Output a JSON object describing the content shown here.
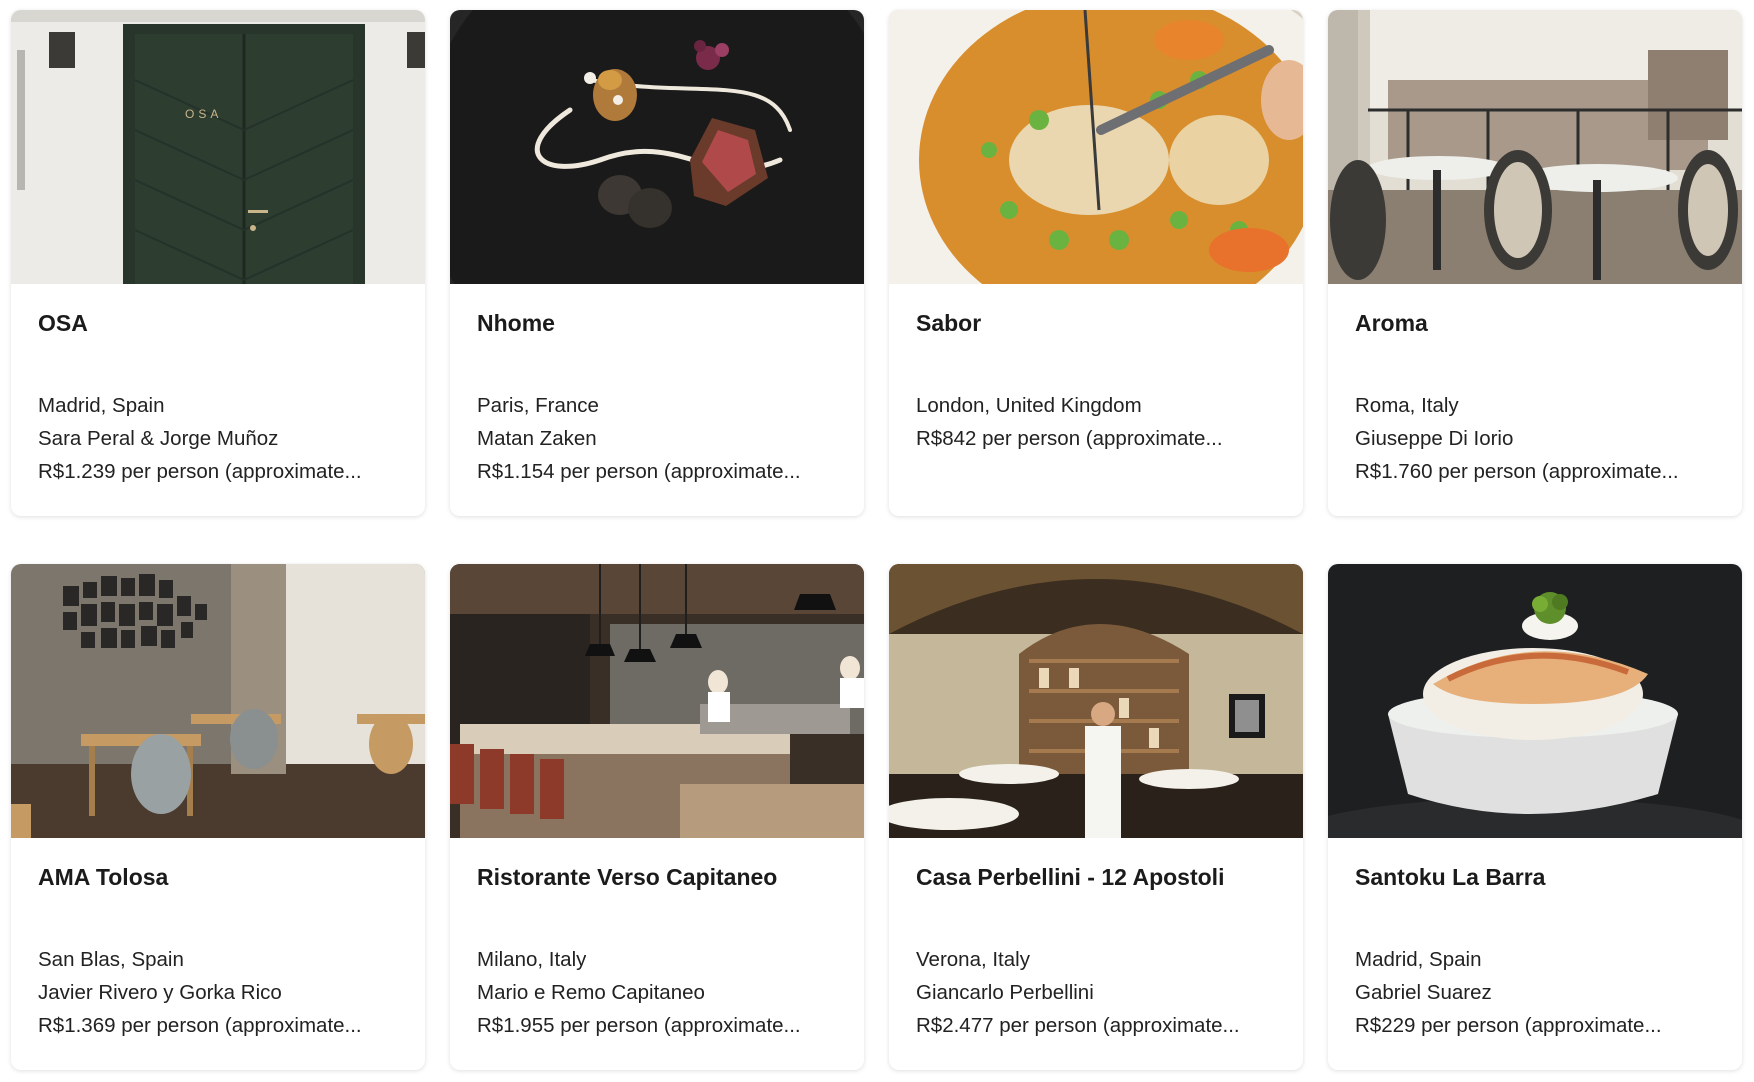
{
  "restaurants": [
    {
      "name": "OSA",
      "location": "Madrid, Spain",
      "chef": "Sara Peral & Jorge Muñoz",
      "price": "R$1.239 per person (approximate...",
      "image": "green-door-photo",
      "door_sign": "OSA"
    },
    {
      "name": "Nhome",
      "location": "Paris, France",
      "chef": "Matan Zaken",
      "price": "R$1.154 per person (approximate...",
      "image": "plated-steak-photo"
    },
    {
      "name": "Sabor",
      "location": "London, United Kingdom",
      "chef": "",
      "price": "R$842 per person (approximate...",
      "image": "stew-bowl-photo"
    },
    {
      "name": "Aroma",
      "location": "Roma, Italy",
      "chef": "Giuseppe Di Iorio",
      "price": "R$1.760 per person (approximate...",
      "image": "rooftop-terrace-photo"
    },
    {
      "name": "AMA Tolosa",
      "location": "San Blas, Spain",
      "chef": "Javier Rivero y Gorka Rico",
      "price": "R$1.369 per person (approximate...",
      "image": "dining-room-photo"
    },
    {
      "name": "Ristorante Verso Capitaneo",
      "location": "Milano, Italy",
      "chef": "Mario e Remo Capitaneo",
      "price": "R$1.955 per person (approximate...",
      "image": "open-kitchen-photo"
    },
    {
      "name": "Casa Perbellini - 12 Apostoli",
      "location": "Verona, Italy",
      "chef": "Giancarlo Perbellini",
      "price": "R$2.477 per person (approximate...",
      "image": "vaulted-hall-photo"
    },
    {
      "name": "Santoku La Barra",
      "location": "Madrid, Spain",
      "chef": "Gabriel Suarez",
      "price": "R$229 per person (approximate...",
      "image": "sushi-bowl-photo"
    }
  ]
}
